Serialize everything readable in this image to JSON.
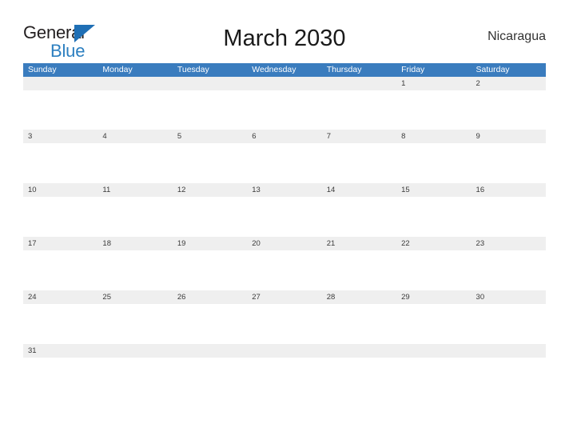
{
  "brand": {
    "word_one": "General",
    "word_two": "Blue",
    "triangle_icon": "triangle-icon",
    "colors": {
      "general_text": "#231f20",
      "blue_text": "#2c7fc0",
      "triangle": "#1f6fb5"
    }
  },
  "header": {
    "title": "March 2030",
    "country": "Nicaragua"
  },
  "calendar": {
    "month": "March",
    "year": "2030",
    "weekday_headers": [
      "Sunday",
      "Monday",
      "Tuesday",
      "Wednesday",
      "Thursday",
      "Friday",
      "Saturday"
    ],
    "colors": {
      "header_background": "#3a7cbe",
      "header_text": "#ffffff",
      "date_band_background": "#efefef",
      "date_text": "#3a3a3a",
      "row_separator": "#2f6da8",
      "cell_background": "#ffffff"
    },
    "weeks": [
      {
        "days": [
          "",
          "",
          "",
          "",
          "",
          "1",
          "2"
        ]
      },
      {
        "days": [
          "3",
          "4",
          "5",
          "6",
          "7",
          "8",
          "9"
        ]
      },
      {
        "days": [
          "10",
          "11",
          "12",
          "13",
          "14",
          "15",
          "16"
        ]
      },
      {
        "days": [
          "17",
          "18",
          "19",
          "20",
          "21",
          "22",
          "23"
        ]
      },
      {
        "days": [
          "24",
          "25",
          "26",
          "27",
          "28",
          "29",
          "30"
        ]
      },
      {
        "days": [
          "31",
          "",
          "",
          "",
          "",
          "",
          ""
        ]
      }
    ]
  }
}
